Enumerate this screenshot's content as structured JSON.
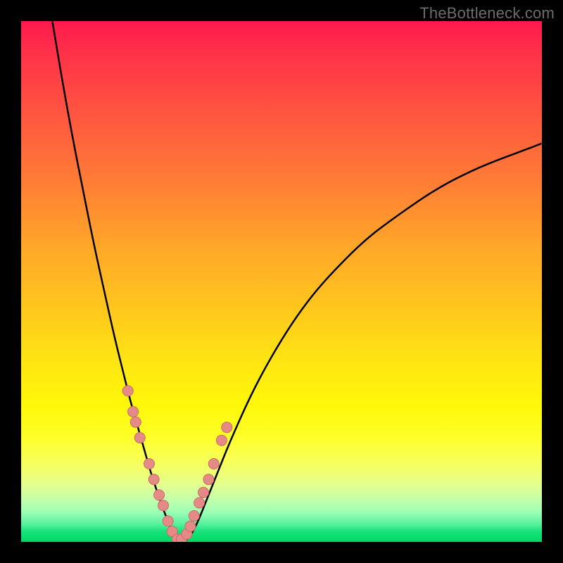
{
  "watermark": "TheBottleneck.com",
  "colors": {
    "frame": "#000000",
    "curve": "#000000",
    "marker_fill": "#e58b87",
    "marker_stroke": "#cc6b67"
  },
  "chart_data": {
    "type": "line",
    "title": "",
    "xlabel": "",
    "ylabel": "",
    "xlim": [
      0,
      100
    ],
    "ylim": [
      0,
      100
    ],
    "grid": false,
    "legend": false,
    "note": "V-shaped bottleneck curve; x is relative position across horizontal axis (0–100), y is percent height (0–100). Minimum near x≈29, y≈0.",
    "series": [
      {
        "name": "curve",
        "x": [
          6.0,
          8.0,
          10.0,
          12.0,
          14.0,
          16.0,
          18.0,
          20.0,
          21.0,
          22.0,
          23.0,
          24.0,
          25.0,
          26.0,
          27.0,
          28.0,
          29.0,
          30.0,
          31.0,
          32.0,
          33.0,
          34.0,
          36.0,
          38.0,
          40.0,
          44.0,
          48.0,
          52.0,
          56.0,
          60.0,
          66.0,
          72.0,
          80.0,
          88.0,
          96.0,
          100.0
        ],
        "y": [
          100.0,
          88.0,
          77.0,
          67.0,
          57.0,
          48.0,
          39.0,
          31.0,
          27.0,
          23.5,
          20.0,
          16.5,
          13.0,
          10.0,
          7.0,
          4.5,
          2.0,
          0.5,
          0.0,
          0.5,
          2.0,
          4.0,
          9.0,
          14.0,
          19.0,
          28.0,
          35.5,
          42.0,
          47.5,
          52.0,
          58.0,
          62.5,
          68.0,
          72.0,
          75.0,
          76.5
        ]
      }
    ],
    "markers": {
      "note": "Pink dot markers clustered around the curve minimum",
      "x": [
        20.5,
        21.5,
        22.0,
        22.8,
        24.6,
        25.5,
        26.5,
        27.3,
        28.2,
        29.0,
        30.0,
        30.8,
        31.8,
        32.5,
        33.2,
        34.2,
        35.0,
        36.0,
        37.0,
        38.5,
        39.5
      ],
      "y": [
        29.0,
        25.0,
        23.0,
        20.0,
        15.0,
        12.0,
        9.0,
        7.0,
        4.0,
        2.0,
        0.5,
        0.5,
        1.5,
        3.0,
        5.0,
        7.5,
        9.5,
        12.0,
        15.0,
        19.5,
        22.0
      ]
    }
  }
}
